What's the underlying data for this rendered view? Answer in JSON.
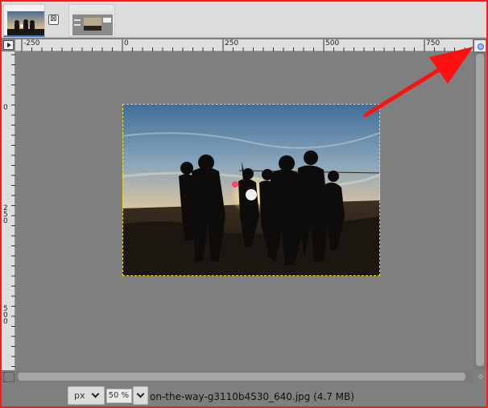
{
  "tabs": [
    {
      "name": "image-tab-active",
      "thumbnail": "silhouettes-sunset-photo"
    },
    {
      "name": "image-tab-2",
      "thumbnail": "screenshot-thumbnail"
    }
  ],
  "tab_close_glyph": "⊠",
  "hruler": {
    "labels": [
      "-250",
      "0",
      "250",
      "500",
      "750"
    ]
  },
  "vruler": {
    "labels": [
      "0",
      "2\n5\n0",
      "5\n0\n0"
    ]
  },
  "image": {
    "description_icon": "photo-silhouettes-icon"
  },
  "statusbar": {
    "unit": "px",
    "zoom": "50 %",
    "file_info": "on-the-way-g3110b4530_640.jpg (4.7 MB)"
  },
  "colors": {
    "frame_border": "#ff1a1a",
    "canvas_bg": "#7f7f7f",
    "selection_border": "#f5e600",
    "annotation_arrow": "#ff1010"
  }
}
